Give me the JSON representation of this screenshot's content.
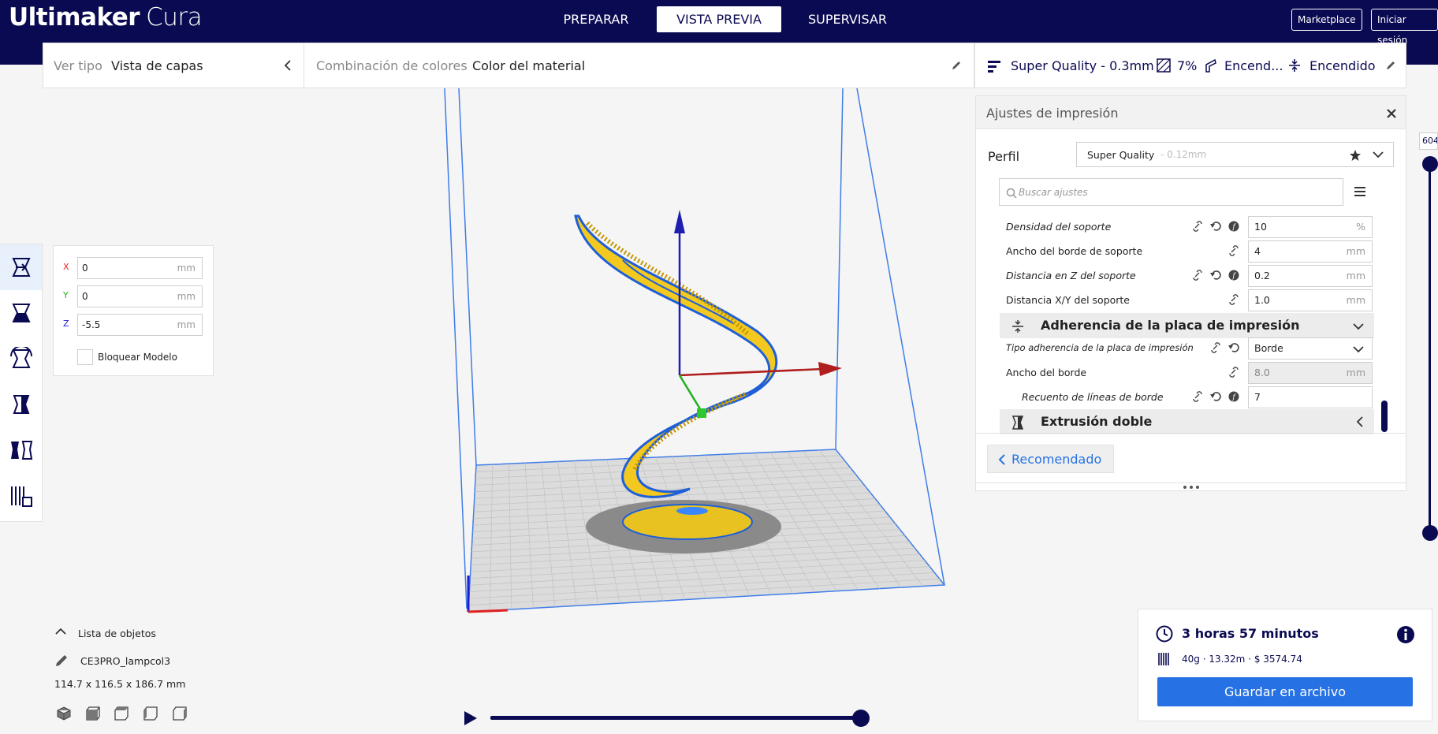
{
  "app": {
    "logo_bold": "Ultimaker",
    "logo_light": "Cura"
  },
  "stages": {
    "prepare": "PREPARAR",
    "preview": "VISTA PREVIA",
    "monitor": "SUPERVISAR"
  },
  "header_buttons": {
    "marketplace": "Marketplace",
    "signin": "Iniciar sesión"
  },
  "view_type": {
    "label": "Ver tipo",
    "value": "Vista de capas"
  },
  "color_scheme": {
    "label": "Combinación de colores",
    "value": "Color del material"
  },
  "print_setup": {
    "profile": "Super Quality - 0.3mm",
    "infill": "7%",
    "support": "Encend...",
    "adhesion": "Encendido"
  },
  "move_tool": {
    "x_label": "X",
    "x": "0",
    "y_label": "Y",
    "y": "0",
    "z_label": "Z",
    "z": "-5.5",
    "unit": "mm",
    "lock_label": "Bloquear Modelo"
  },
  "settings": {
    "title": "Ajustes de impresión",
    "profile_label": "Perfil",
    "profile_name": "Super Quality",
    "profile_suffix": " - 0.12mm",
    "search_placeholder": "Buscar ajustes",
    "rows": [
      {
        "label": "Densidad del soporte",
        "value": "10",
        "unit": "%"
      },
      {
        "label": "Ancho del borde de soporte",
        "value": "4",
        "unit": "mm"
      },
      {
        "label": "Distancia en Z del soporte",
        "value": "0.2",
        "unit": "mm"
      },
      {
        "label": "Distancia X/Y del soporte",
        "value": "1.0",
        "unit": "mm"
      }
    ],
    "category_adhesion": "Adherencia de la placa de impresión",
    "adhesion_rows": [
      {
        "label": "Tipo adherencia de la placa de impresión",
        "value": "Borde"
      },
      {
        "label": "Ancho del borde",
        "value": "8.0",
        "unit": "mm"
      },
      {
        "label": "Recuento de líneas de borde",
        "value": "7"
      }
    ],
    "category_dual": "Extrusión doble",
    "recommended": "Recomendado"
  },
  "layer_slider": {
    "value": "604"
  },
  "object_list": {
    "title": "Lista de objetos",
    "name": "CE3PRO_lampcol3",
    "dims": "114.7 x 116.5 x 186.7 mm"
  },
  "estimate": {
    "time": "3 horas 57 minutos",
    "details": "40g · 13.32m · $ 3574.74",
    "save": "Guardar en archivo"
  },
  "colors": {
    "header": "#0a0a52",
    "accent": "#2671e3",
    "model": "#f3c81f",
    "outline": "#1e5fd8"
  }
}
